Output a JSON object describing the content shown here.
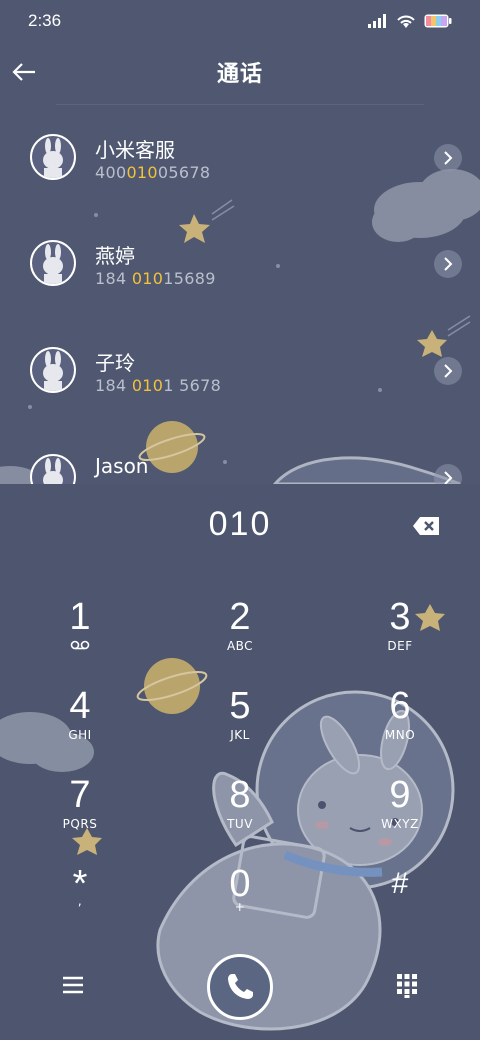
{
  "status_bar": {
    "time": "2:36"
  },
  "header": {
    "title": "通话"
  },
  "contacts": [
    {
      "name": "小米客服",
      "number_pre": "400",
      "number_match": "010",
      "number_post": "05678"
    },
    {
      "name": "燕婷",
      "number_pre": "184 ",
      "number_match": "010",
      "number_post": "15689"
    },
    {
      "name": "子玲",
      "number_pre": "184 ",
      "number_match": "010",
      "number_post": "1 5678"
    },
    {
      "name": "Jason",
      "number_pre": "",
      "number_match": "",
      "number_post": ""
    }
  ],
  "dialer": {
    "display": "010",
    "keys": [
      {
        "main": "1",
        "sub": ""
      },
      {
        "main": "2",
        "sub": "ABC"
      },
      {
        "main": "3",
        "sub": "DEF"
      },
      {
        "main": "4",
        "sub": "GHI"
      },
      {
        "main": "5",
        "sub": "JKL"
      },
      {
        "main": "6",
        "sub": "MNO"
      },
      {
        "main": "7",
        "sub": "PQRS"
      },
      {
        "main": "8",
        "sub": "TUV"
      },
      {
        "main": "9",
        "sub": "WXYZ"
      },
      {
        "main": "*",
        "sub": ","
      },
      {
        "main": "0",
        "sub": "+"
      },
      {
        "main": "#",
        "sub": ""
      }
    ]
  },
  "colors": {
    "background": "#4f5870",
    "highlight": "#f2c23a",
    "secondary_text": "#b9bfcd"
  },
  "icons": {
    "back": "arrow-left-icon",
    "chevron": "chevron-right-icon",
    "backspace": "backspace-icon",
    "voicemail": "voicemail-icon",
    "menu": "menu-icon",
    "call": "phone-icon",
    "keypad": "keypad-icon"
  }
}
